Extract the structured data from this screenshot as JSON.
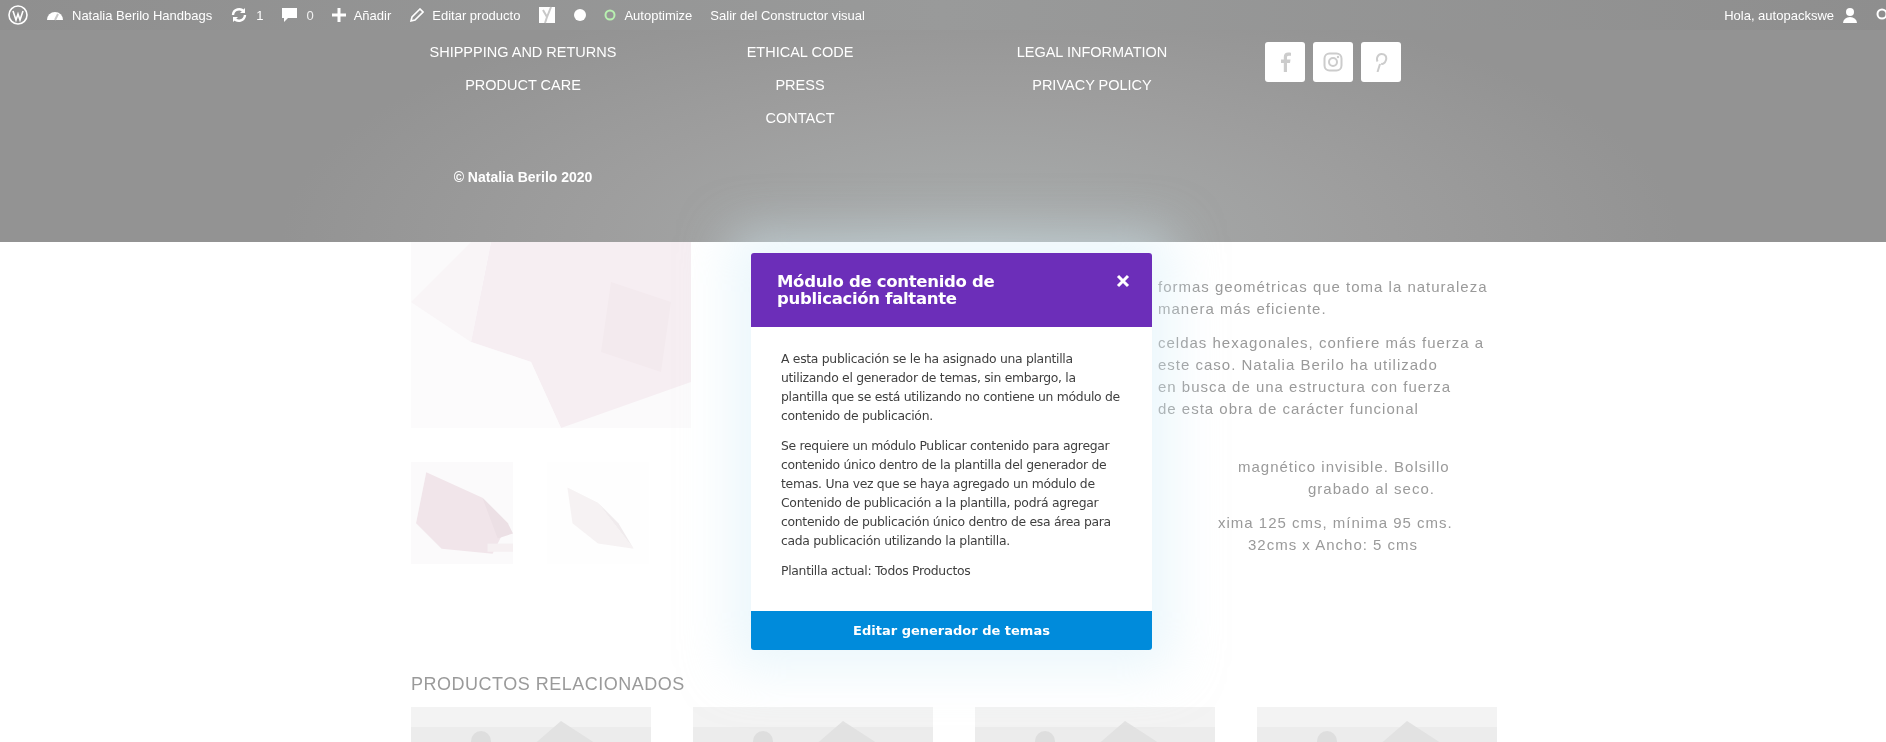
{
  "admin_bar": {
    "items": [
      {
        "kind": "logo"
      },
      {
        "kind": "site",
        "label": "Natalia Berilo Handbags"
      },
      {
        "kind": "updates",
        "label": "1"
      },
      {
        "kind": "comments",
        "label": "0"
      },
      {
        "kind": "new",
        "label": "Añadir"
      },
      {
        "kind": "edit",
        "label": "Editar producto"
      },
      {
        "kind": "seo"
      },
      {
        "kind": "dot"
      },
      {
        "kind": "status",
        "label": "Autoptimize"
      },
      {
        "kind": "text",
        "label": "Salir del Constructor visual"
      }
    ],
    "greeting": "Hola, autopackswe"
  },
  "footer": {
    "columns": [
      [
        "SHIPPPING AND RETURNS",
        "PRODUCT CARE"
      ],
      [
        "ETHICAL CODE",
        "PRESS",
        "CONTACT"
      ],
      [
        "LEGAL INFORMATION",
        "PRIVACY POLICY"
      ]
    ],
    "social": [
      {
        "kind": "facebook"
      },
      {
        "kind": "instagram"
      },
      {
        "kind": "pinterest"
      }
    ],
    "copyright": "© Natalia Berilo 2020"
  },
  "product": {
    "description_lines": [
      "formas geométricas que toma la naturaleza",
      "manera más eficiente.",
      "celdas hexagonales, confiere más fuerza a",
      "este caso. Natalia Berilo ha utilizado",
      "en busca de una estructura con fuerza",
      "de esta obra de carácter funcional",
      "magnético invisible. Bolsillo",
      "grabado al seco.",
      "xima 125 cms, mínima 95 cms.",
      "32cms x Ancho: 5 cms"
    ],
    "related_heading": "PRODUCTOS RELACIONADOS"
  },
  "modal": {
    "title": "Módulo de contenido de publicación faltante",
    "paragraphs": [
      "A esta publicación se le ha asignado una plantilla utilizando el generador de temas, sin embargo, la plantilla que se está utilizando no contiene un módulo de contenido de publicación.",
      "Se requiere un módulo Publicar contenido para agregar contenido único dentro de la plantilla del generador de temas. Una vez que se haya agregado un módulo de Contenido de publicación a la plantilla, podrá agregar contenido de publicación único dentro de esa área para cada publicación utilizando la plantilla.",
      "Plantilla actual: Todos Productos"
    ],
    "button": "Editar generador de temas"
  }
}
